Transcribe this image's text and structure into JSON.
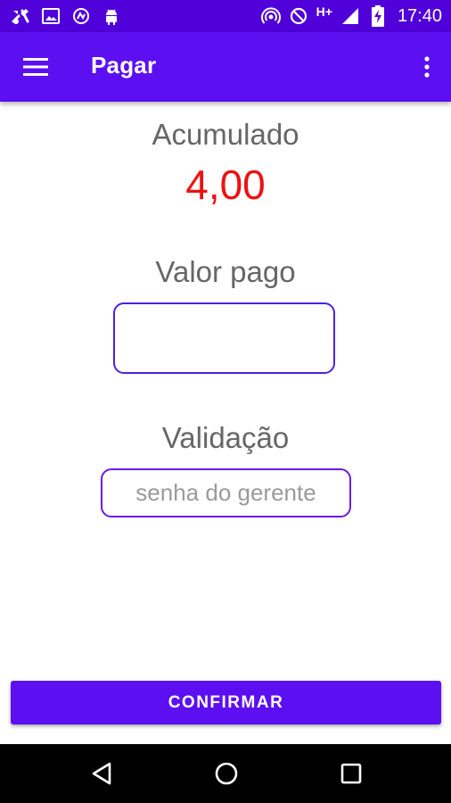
{
  "status_bar": {
    "left_icons": [
      "tools-notification-icon",
      "image-notification-icon",
      "sync-notification-icon",
      "android-notification-icon"
    ],
    "right_icons": [
      "hotspot-icon",
      "do-not-disturb-icon",
      "signal-icon",
      "battery-charging-icon"
    ],
    "network_type": "H+",
    "time": "17:40"
  },
  "toolbar": {
    "title": "Pagar",
    "menu_icon": "hamburger-menu-icon",
    "overflow_icon": "more-vertical-icon"
  },
  "accumulated": {
    "label": "Acumulado",
    "value": "4,00"
  },
  "paid": {
    "label": "Valor pago",
    "value": "",
    "placeholder": ""
  },
  "validation": {
    "label": "Validação",
    "value": "",
    "placeholder": "senha do gerente"
  },
  "confirm_button": {
    "label": "CONFIRMAR"
  },
  "nav_bar": {
    "back_icon": "back-triangle-icon",
    "home_icon": "home-circle-icon",
    "recents_icon": "recents-square-icon"
  },
  "colors": {
    "primary": "#5c0ff0",
    "status_bar": "#5000d8",
    "accumulated_value": "#ee1111",
    "label_text": "#666666",
    "input_border": "#4a22e0"
  }
}
